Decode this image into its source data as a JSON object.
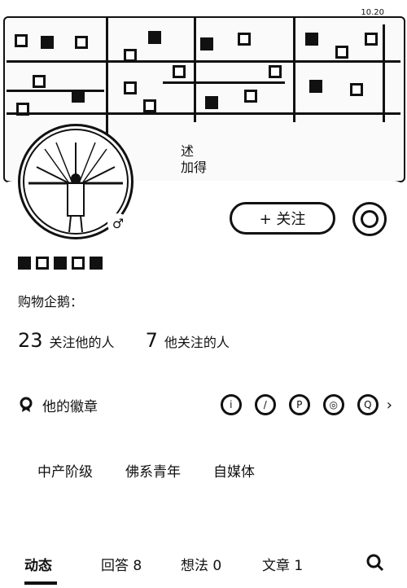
{
  "cover": {
    "sign_text": "述\n加得",
    "time_text": "10.20"
  },
  "profile": {
    "gender_icon": "♂",
    "bio": "购物企鹅：",
    "followers_count": "23",
    "followers_label": "关注他的人",
    "following_count": "7",
    "following_label": "他关注的人"
  },
  "actions": {
    "follow_label": "+ 关注"
  },
  "badges": {
    "title": "他的徽章",
    "chevron": "›",
    "icon_names": [
      "badge-1-icon",
      "badge-2-icon",
      "badge-3-icon",
      "badge-4-icon",
      "badge-5-icon"
    ]
  },
  "tags": [
    "中产阶级",
    "佛系青年",
    "自媒体"
  ],
  "tabs": [
    {
      "label": "动态"
    },
    {
      "label": "回答 8"
    },
    {
      "label": "想法 0"
    },
    {
      "label": "文章 1"
    }
  ],
  "colors": {
    "ink": "#111111",
    "bg": "#ffffff"
  }
}
